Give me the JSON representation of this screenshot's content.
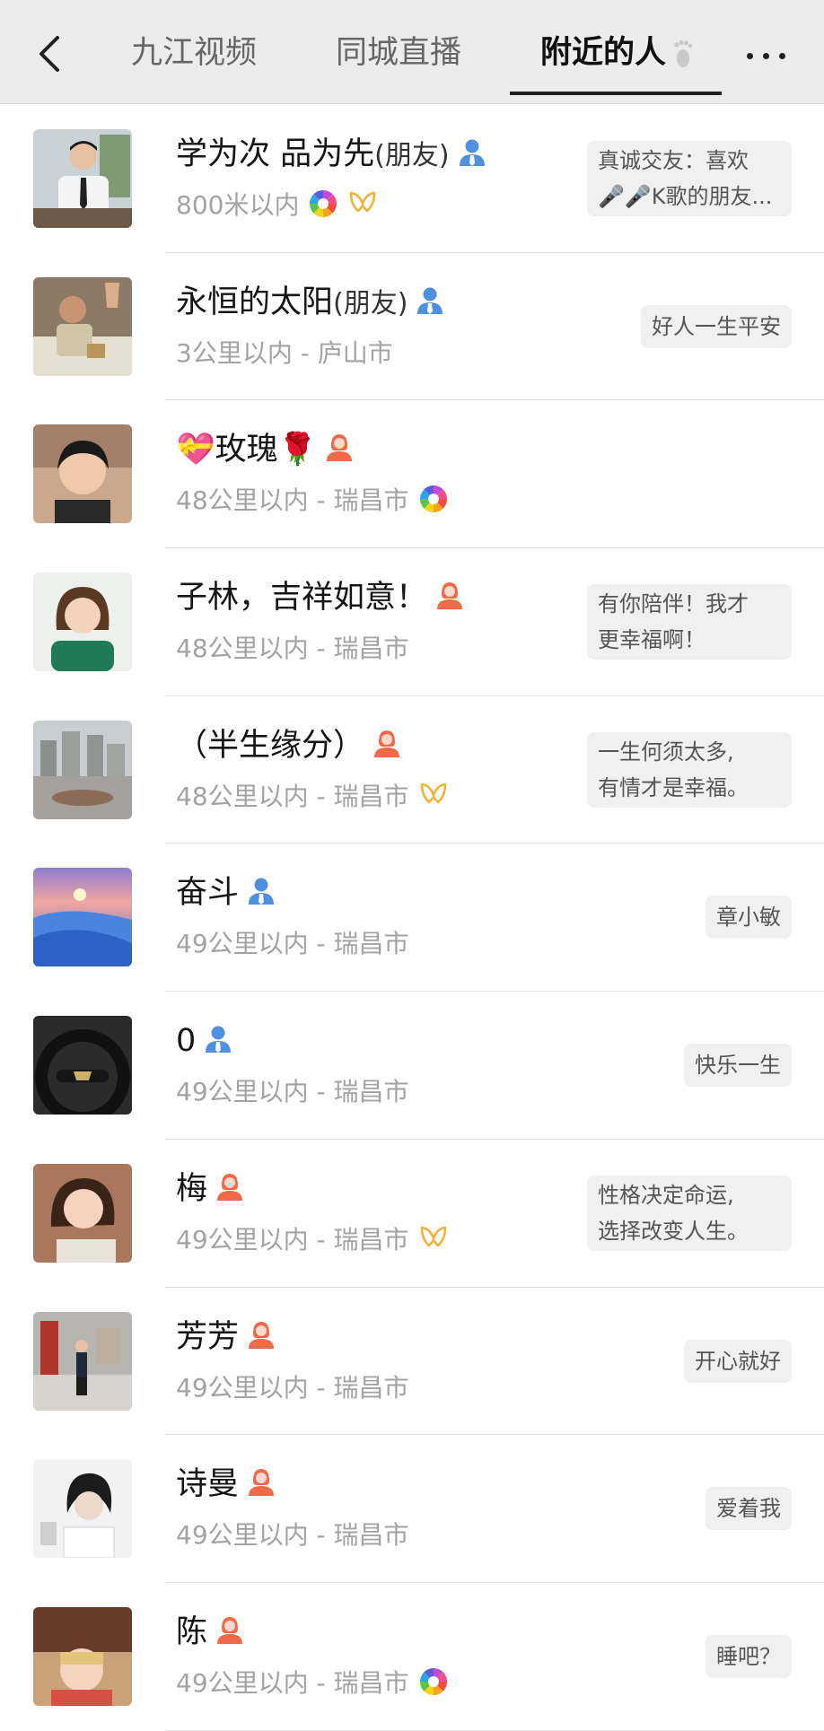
{
  "header": {
    "tabs": [
      {
        "label": "九江视频",
        "active": false
      },
      {
        "label": "同城直播",
        "active": false
      },
      {
        "label": "附近的人",
        "active": true
      }
    ],
    "back_icon": "chevron-left-icon",
    "footprint_icon": "footprint-icon",
    "more_icon": "more-dots-icon"
  },
  "colors": {
    "male": "#4e8fe0",
    "female": "#ef6a48",
    "distance": "#a3a3a3",
    "bubble_bg": "#f0f0f0"
  },
  "people": [
    {
      "name": "学为次  品为先",
      "suffix": "(朋友)",
      "gender": "male",
      "distance": "800米以内",
      "extras": [
        "moments-icon",
        "ribbon-icon"
      ],
      "signature": [
        "真诚交友：喜欢",
        "🎤🎤K歌的朋友..."
      ]
    },
    {
      "name": "永恒的太阳",
      "suffix": "(朋友)",
      "gender": "male",
      "distance": "3公里以内 - 庐山市",
      "extras": [],
      "signature": [
        "好人一生平安"
      ]
    },
    {
      "name": "💝玫瑰🌹",
      "suffix": "",
      "gender": "female",
      "distance": "48公里以内 - 瑞昌市",
      "extras": [
        "moments-icon"
      ],
      "signature": []
    },
    {
      "name": "子林，吉祥如意！",
      "suffix": "",
      "gender": "female",
      "distance": "48公里以内 - 瑞昌市",
      "extras": [],
      "signature": [
        "有你陪伴！我才",
        "更幸福啊！"
      ]
    },
    {
      "name": "（半生缘分）",
      "suffix": "",
      "gender": "female",
      "distance": "48公里以内 - 瑞昌市",
      "extras": [
        "ribbon-icon"
      ],
      "signature": [
        "一生何须太多,",
        "有情才是幸福。"
      ]
    },
    {
      "name": "奋斗",
      "suffix": "",
      "gender": "male",
      "distance": "49公里以内 - 瑞昌市",
      "extras": [],
      "signature": [
        "章小敏"
      ]
    },
    {
      "name": "0",
      "suffix": "",
      "gender": "male",
      "distance": "49公里以内 - 瑞昌市",
      "extras": [],
      "signature": [
        "快乐一生"
      ]
    },
    {
      "name": "梅",
      "suffix": "",
      "gender": "female",
      "distance": "49公里以内 - 瑞昌市",
      "extras": [
        "ribbon-icon"
      ],
      "signature": [
        "性格决定命运,",
        "选择改变人生。"
      ]
    },
    {
      "name": "芳芳",
      "suffix": "",
      "gender": "female",
      "distance": "49公里以内 - 瑞昌市",
      "extras": [],
      "signature": [
        "开心就好"
      ]
    },
    {
      "name": "诗曼",
      "suffix": "",
      "gender": "female",
      "distance": "49公里以内 - 瑞昌市",
      "extras": [],
      "signature": [
        "爱着我"
      ]
    },
    {
      "name": "陈",
      "suffix": "",
      "gender": "female",
      "distance": "49公里以内 - 瑞昌市",
      "extras": [
        "moments-icon"
      ],
      "signature": [
        "睡吧？"
      ]
    }
  ]
}
